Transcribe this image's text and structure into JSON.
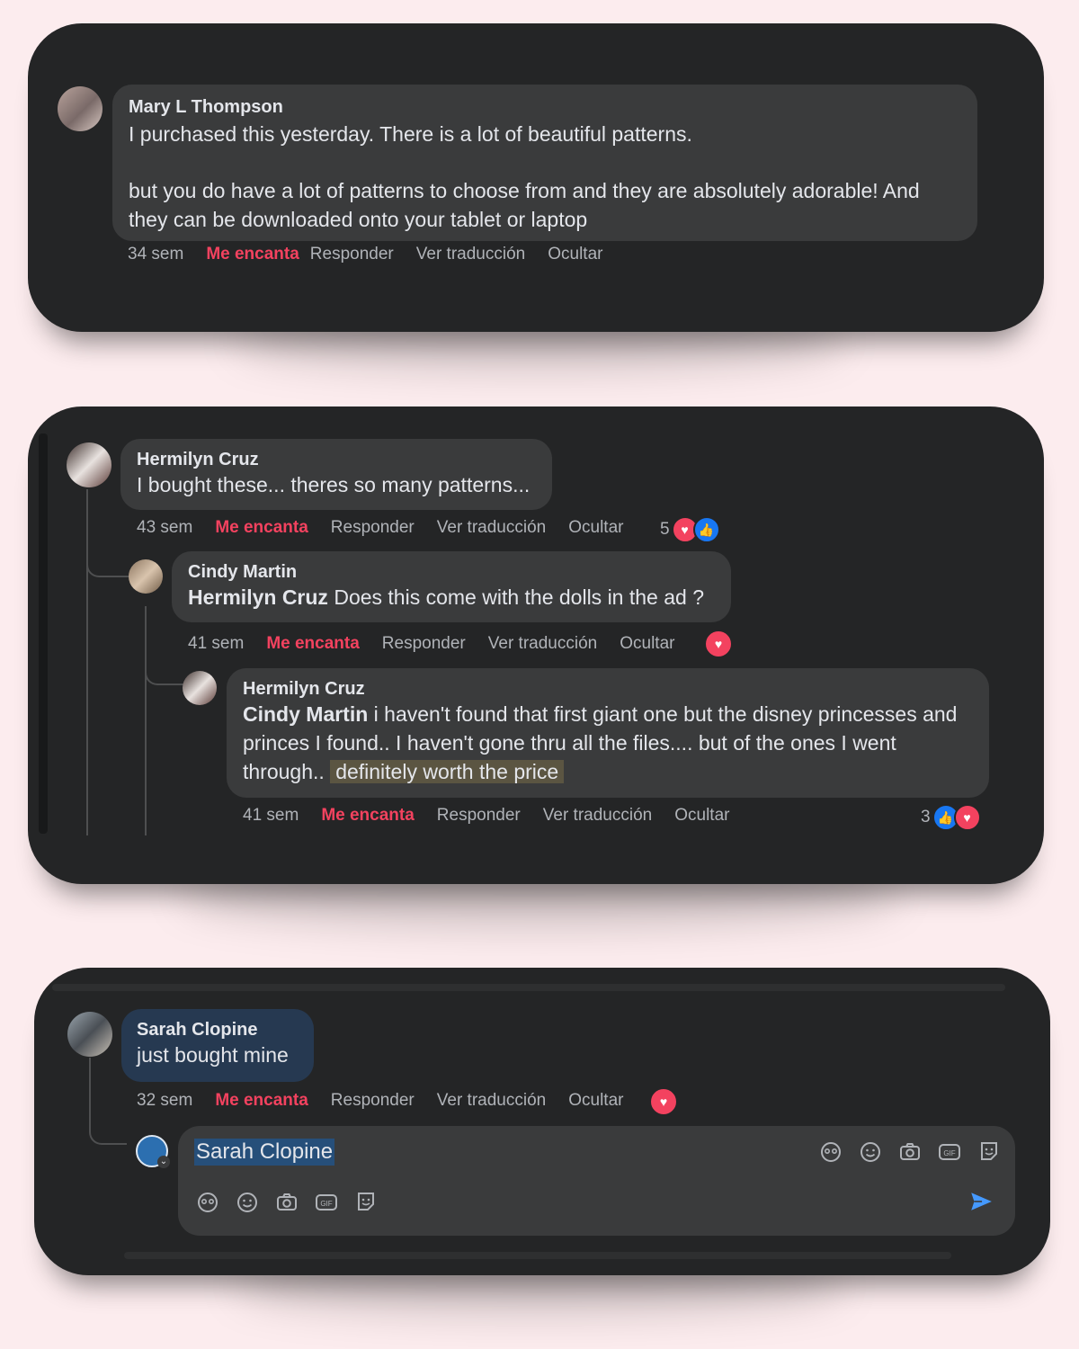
{
  "card1": {
    "author": "Mary L Thompson",
    "text_p1": "I purchased this yesterday. There is a lot of beautiful patterns.",
    "text_p2": "but you do have a lot of patterns to choose from and they are absolutely adorable! And they can be downloaded onto your tablet or laptop",
    "time": "34 sem",
    "love": "Me encanta",
    "reply": "Responder",
    "translate": "Ver traducción",
    "hide": "Ocultar"
  },
  "card2": {
    "c1": {
      "author": "Hermilyn Cruz",
      "text": "I bought these... theres so many patterns...",
      "time": "43 sem",
      "love": "Me encanta",
      "reply": "Responder",
      "translate": "Ver traducción",
      "hide": "Ocultar",
      "reaction_count": "5"
    },
    "c2": {
      "author": "Cindy Martin",
      "mention": "Hermilyn Cruz",
      "text": " Does this come with the dolls in the ad ?",
      "time": "41 sem",
      "love": "Me encanta",
      "reply": "Responder",
      "translate": "Ver traducción",
      "hide": "Ocultar"
    },
    "c3": {
      "author": "Hermilyn Cruz",
      "mention": "Cindy Martin",
      "text": " i haven't found that first giant one but the disney princesses and princes I found.. I haven't gone thru all the files.... but of the ones I went through..",
      "highlight": "definitely worth the price",
      "time": "41 sem",
      "love": "Me encanta",
      "reply": "Responder",
      "translate": "Ver traducción",
      "hide": "Ocultar",
      "reaction_count": "3"
    }
  },
  "card3": {
    "author": "Sarah Clopine",
    "text": "just bought mine",
    "time": "32 sem",
    "love": "Me encanta",
    "reply": "Responder",
    "translate": "Ver traducción",
    "hide": "Ocultar",
    "composer_value": "Sarah Clopine"
  },
  "colors": {
    "background": "#fcecee",
    "card": "#242526",
    "bubble": "#3a3b3c",
    "love_accent": "#f3425f",
    "like_blue": "#1877f2",
    "send_blue": "#4599ff"
  }
}
